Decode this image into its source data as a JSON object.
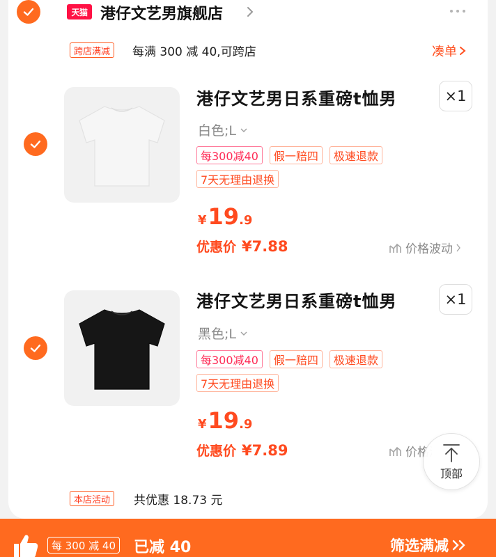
{
  "store": {
    "badge": "天猫",
    "name": "港仔文艺男旗舰店",
    "checked": true
  },
  "promo": {
    "tag": "跨店满减",
    "text": "每满 300 减 40,可跨店",
    "link": "凑单"
  },
  "items": [
    {
      "title": "港仔文艺男日系重磅t恤男",
      "sku": "白色;L",
      "qty": "×1",
      "tags": [
        "每300减40",
        "假一赔四",
        "极速退款",
        "7天无理由退换"
      ],
      "price_symbol": "¥",
      "price_int": "19",
      "price_dec": ".9",
      "discount_label": "优惠价",
      "discount_amount": "¥7.88",
      "trend_label": "价格波动",
      "shirt_color": "#f6f6f6",
      "checked": true
    },
    {
      "title": "港仔文艺男日系重磅t恤男",
      "sku": "黑色;L",
      "qty": "×1",
      "tags": [
        "每300减40",
        "假一赔四",
        "极速退款",
        "7天无理由退换"
      ],
      "price_symbol": "¥",
      "price_int": "19",
      "price_dec": ".9",
      "discount_label": "优惠价",
      "discount_amount": "¥7.89",
      "trend_label": "价格波动",
      "shirt_color": "#161616",
      "checked": true
    }
  ],
  "back_to_top": "顶部",
  "store_activity": {
    "tag": "本店活动",
    "text": "共优惠 18.73 元"
  },
  "bottom_bar": {
    "tag": "每 300 减 40",
    "reduced": "已减 40",
    "filter": "筛选满减"
  },
  "colors": {
    "accent": "#ff6a1f",
    "price": "#ff4a1f",
    "tmall": "#ff1144"
  },
  "icons": {
    "check": "check-icon",
    "more": "more-icon",
    "thumbs_up": "thumbs-up-icon",
    "back_to_top": "arrow-up-icon",
    "trend": "chart-icon"
  }
}
